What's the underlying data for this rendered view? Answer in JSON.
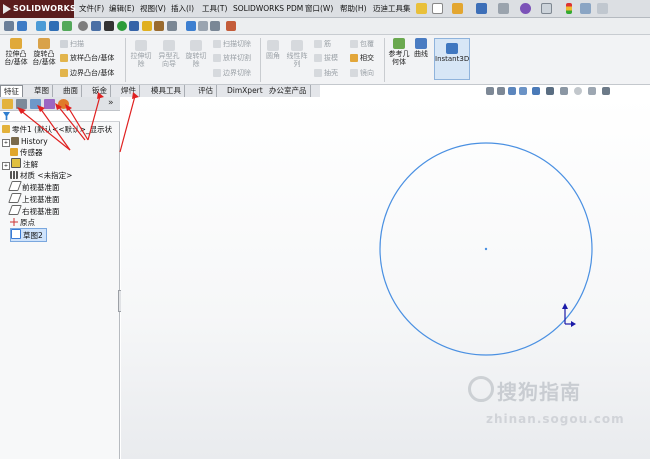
{
  "app": {
    "logo_text": "SOLIDWORKS"
  },
  "menu": {
    "items": [
      "文件(F)",
      "编辑(E)",
      "视图(V)",
      "插入(I)",
      "工具(T)",
      "SOLIDWORKS PDM",
      "窗口(W)",
      "帮助(H)",
      "迈迪工具集"
    ]
  },
  "ribbon": {
    "extrude_boss": "拉伸凸台/基体",
    "revolve_boss": "旋转凸台/基体",
    "sweep": "扫描",
    "loft": "放样凸台/基体",
    "boundary": "边界凸台/基体",
    "extrude_cut": "拉伸切除",
    "hole_wizard": "异型孔向导",
    "revolve_cut": "旋转切除",
    "swept_cut": "扫描切除",
    "lofted_cut": "放样切割",
    "boundary_cut": "边界切除",
    "fillet": "圆角",
    "linear_pattern": "线性阵列",
    "rib": "筋",
    "draft": "拔模",
    "shell": "抽壳",
    "wrap": "包覆",
    "intersect": "相交",
    "mirror": "镜向",
    "ref_geometry": "参考几何体",
    "curves": "曲线",
    "instant3d": "Instant3D"
  },
  "tabs": [
    {
      "label": "特征",
      "active": true
    },
    {
      "label": "草图",
      "active": false
    },
    {
      "label": "曲面",
      "active": false
    },
    {
      "label": "钣金",
      "active": false
    },
    {
      "label": "焊件",
      "active": false
    },
    {
      "label": "模具工具",
      "active": false
    },
    {
      "label": "评估",
      "active": false
    },
    {
      "label": "DimXpert",
      "active": false
    },
    {
      "label": "办公室产品",
      "active": false
    }
  ],
  "feature_tree": {
    "root": "零件1 (默认<<默认>_显示状",
    "items": [
      {
        "label": "History",
        "icon": "history-icon",
        "expandable": true
      },
      {
        "label": "传感器",
        "icon": "sensor-icon",
        "expandable": false
      },
      {
        "label": "注解",
        "icon": "annotation-icon",
        "expandable": true
      },
      {
        "label": "材质 <未指定>",
        "icon": "material-icon",
        "expandable": false
      },
      {
        "label": "前视基准面",
        "icon": "plane-icon",
        "expandable": false
      },
      {
        "label": "上视基准面",
        "icon": "plane-icon",
        "expandable": false
      },
      {
        "label": "右视基准面",
        "icon": "plane-icon",
        "expandable": false
      },
      {
        "label": "原点",
        "icon": "origin-icon",
        "expandable": false
      },
      {
        "label": "草图2",
        "icon": "sketch-icon",
        "expandable": false,
        "selected": true
      }
    ],
    "panel_expand": "»"
  },
  "watermark": {
    "text": "搜狗指南",
    "url": "zhinan.sogou.com"
  },
  "colors": {
    "sketch_circle": "#4a90e2",
    "selection": "#cfe3fb",
    "logo_bg": "#5a1d1d",
    "annotation_arrow": "#e02020"
  }
}
